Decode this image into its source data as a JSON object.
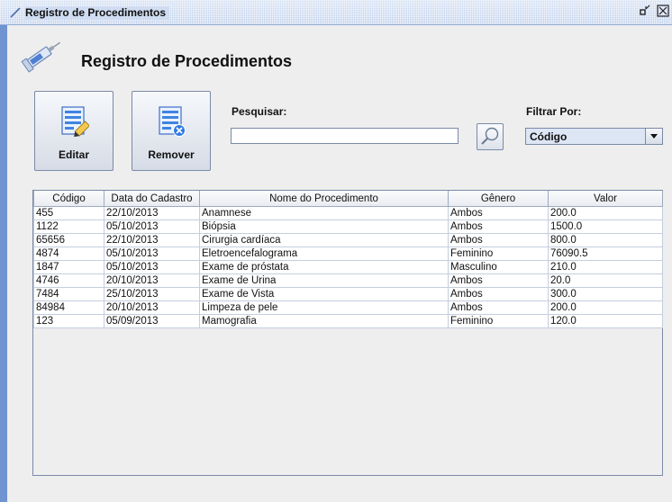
{
  "window": {
    "title": "Registro de Procedimentos",
    "icon": "syringe-icon",
    "buttons": {
      "restore": "restore-icon",
      "close": "close-icon"
    }
  },
  "header": {
    "title": "Registro de Procedimentos",
    "icon": "syringe-icon"
  },
  "toolbar": {
    "edit_label": "Editar",
    "remove_label": "Remover"
  },
  "search": {
    "label": "Pesquisar:",
    "value": "",
    "button_icon": "search-icon"
  },
  "filter": {
    "label": "Filtrar Por:",
    "selected": "Código"
  },
  "table": {
    "columns": [
      "Código",
      "Data do Cadastro",
      "Nome do Procedimento",
      "Gênero",
      "Valor"
    ],
    "rows": [
      [
        "455",
        "22/10/2013",
        "Anamnese",
        "Ambos",
        "200.0"
      ],
      [
        "1122",
        "05/10/2013",
        "Biópsia",
        "Ambos",
        "1500.0"
      ],
      [
        "65656",
        "22/10/2013",
        "Cirurgia cardíaca",
        "Ambos",
        "800.0"
      ],
      [
        "4874",
        "05/10/2013",
        "Eletroencefalograma",
        "Feminino",
        "76090.5"
      ],
      [
        "1847",
        "05/10/2013",
        "Exame de próstata",
        "Masculino",
        "210.0"
      ],
      [
        "4746",
        "20/10/2013",
        "Exame de Urina",
        "Ambos",
        "20.0"
      ],
      [
        "7484",
        "25/10/2013",
        "Exame de Vista",
        "Ambos",
        "300.0"
      ],
      [
        "84984",
        "20/10/2013",
        "Limpeza de pele",
        "Ambos",
        "200.0"
      ],
      [
        "123",
        "05/09/2013",
        "Mamografia",
        "Feminino",
        "120.0"
      ]
    ]
  }
}
